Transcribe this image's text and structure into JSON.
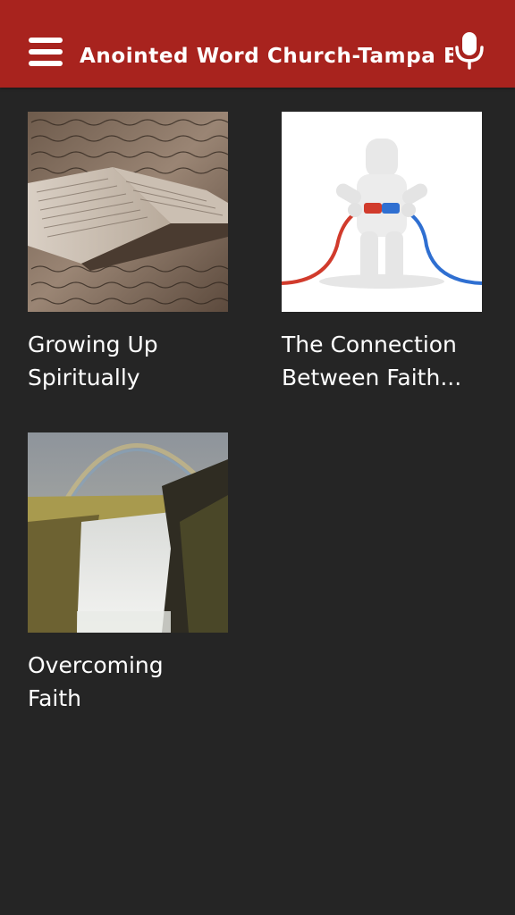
{
  "header": {
    "title": "Anointed Word Church-Tampa Ba",
    "background_color": "#a8231e",
    "menu_icon": "hamburger-menu-icon",
    "mic_icon": "microphone-icon"
  },
  "content": {
    "background_color": "#252525",
    "items": [
      {
        "title": "Growing Up\nSpiritually",
        "image": "open-bible-manuscript-image"
      },
      {
        "title": "The Connection\nBetween Faith...",
        "image": "figure-connecting-cables-image"
      },
      {
        "title": "Overcoming\nFaith",
        "image": "waterfall-rainbow-image"
      }
    ]
  }
}
